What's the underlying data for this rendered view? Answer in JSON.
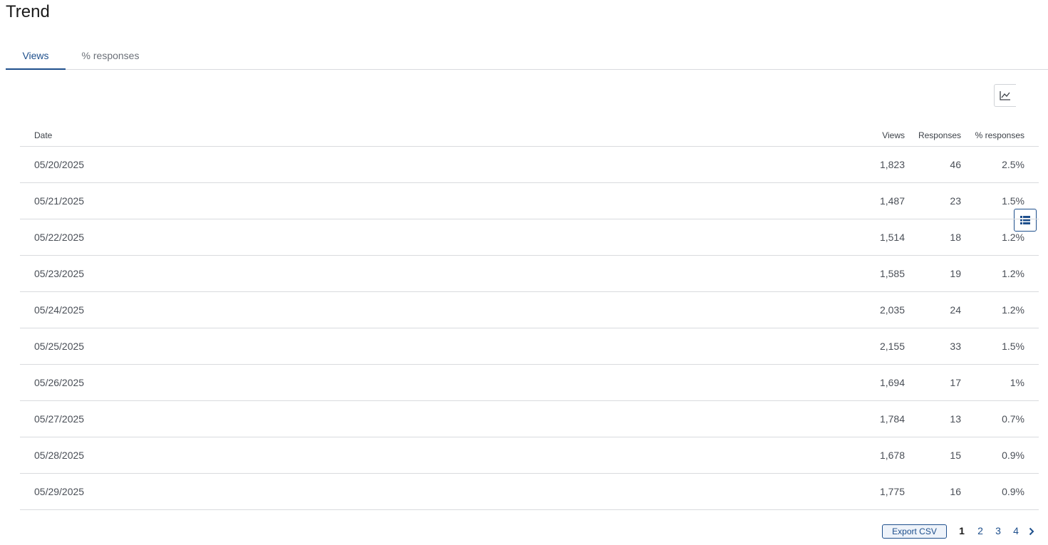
{
  "page": {
    "title": "Trend"
  },
  "tabs": [
    {
      "label": "Views",
      "active": true
    },
    {
      "label": "% responses",
      "active": false
    }
  ],
  "view_toggle": {
    "options": [
      {
        "icon": "line-chart-icon",
        "active": false
      },
      {
        "icon": "list-icon",
        "active": true
      }
    ]
  },
  "table": {
    "columns": [
      "Date",
      "Views",
      "Responses",
      "% responses"
    ],
    "rows": [
      {
        "date": "05/20/2025",
        "views": "1,823",
        "responses": "46",
        "pct": "2.5%"
      },
      {
        "date": "05/21/2025",
        "views": "1,487",
        "responses": "23",
        "pct": "1.5%"
      },
      {
        "date": "05/22/2025",
        "views": "1,514",
        "responses": "18",
        "pct": "1.2%"
      },
      {
        "date": "05/23/2025",
        "views": "1,585",
        "responses": "19",
        "pct": "1.2%"
      },
      {
        "date": "05/24/2025",
        "views": "2,035",
        "responses": "24",
        "pct": "1.2%"
      },
      {
        "date": "05/25/2025",
        "views": "2,155",
        "responses": "33",
        "pct": "1.5%"
      },
      {
        "date": "05/26/2025",
        "views": "1,694",
        "responses": "17",
        "pct": "1%"
      },
      {
        "date": "05/27/2025",
        "views": "1,784",
        "responses": "13",
        "pct": "0.7%"
      },
      {
        "date": "05/28/2025",
        "views": "1,678",
        "responses": "15",
        "pct": "0.9%"
      },
      {
        "date": "05/29/2025",
        "views": "1,775",
        "responses": "16",
        "pct": "0.9%"
      }
    ]
  },
  "footer": {
    "export_label": "Export CSV",
    "pages": [
      "1",
      "2",
      "3",
      "4"
    ],
    "current_page": "1",
    "next_icon": "chevron-right-icon"
  },
  "colors": {
    "accent": "#1e4f8c",
    "border": "#d9dbde",
    "muted_text": "#6b7078"
  }
}
